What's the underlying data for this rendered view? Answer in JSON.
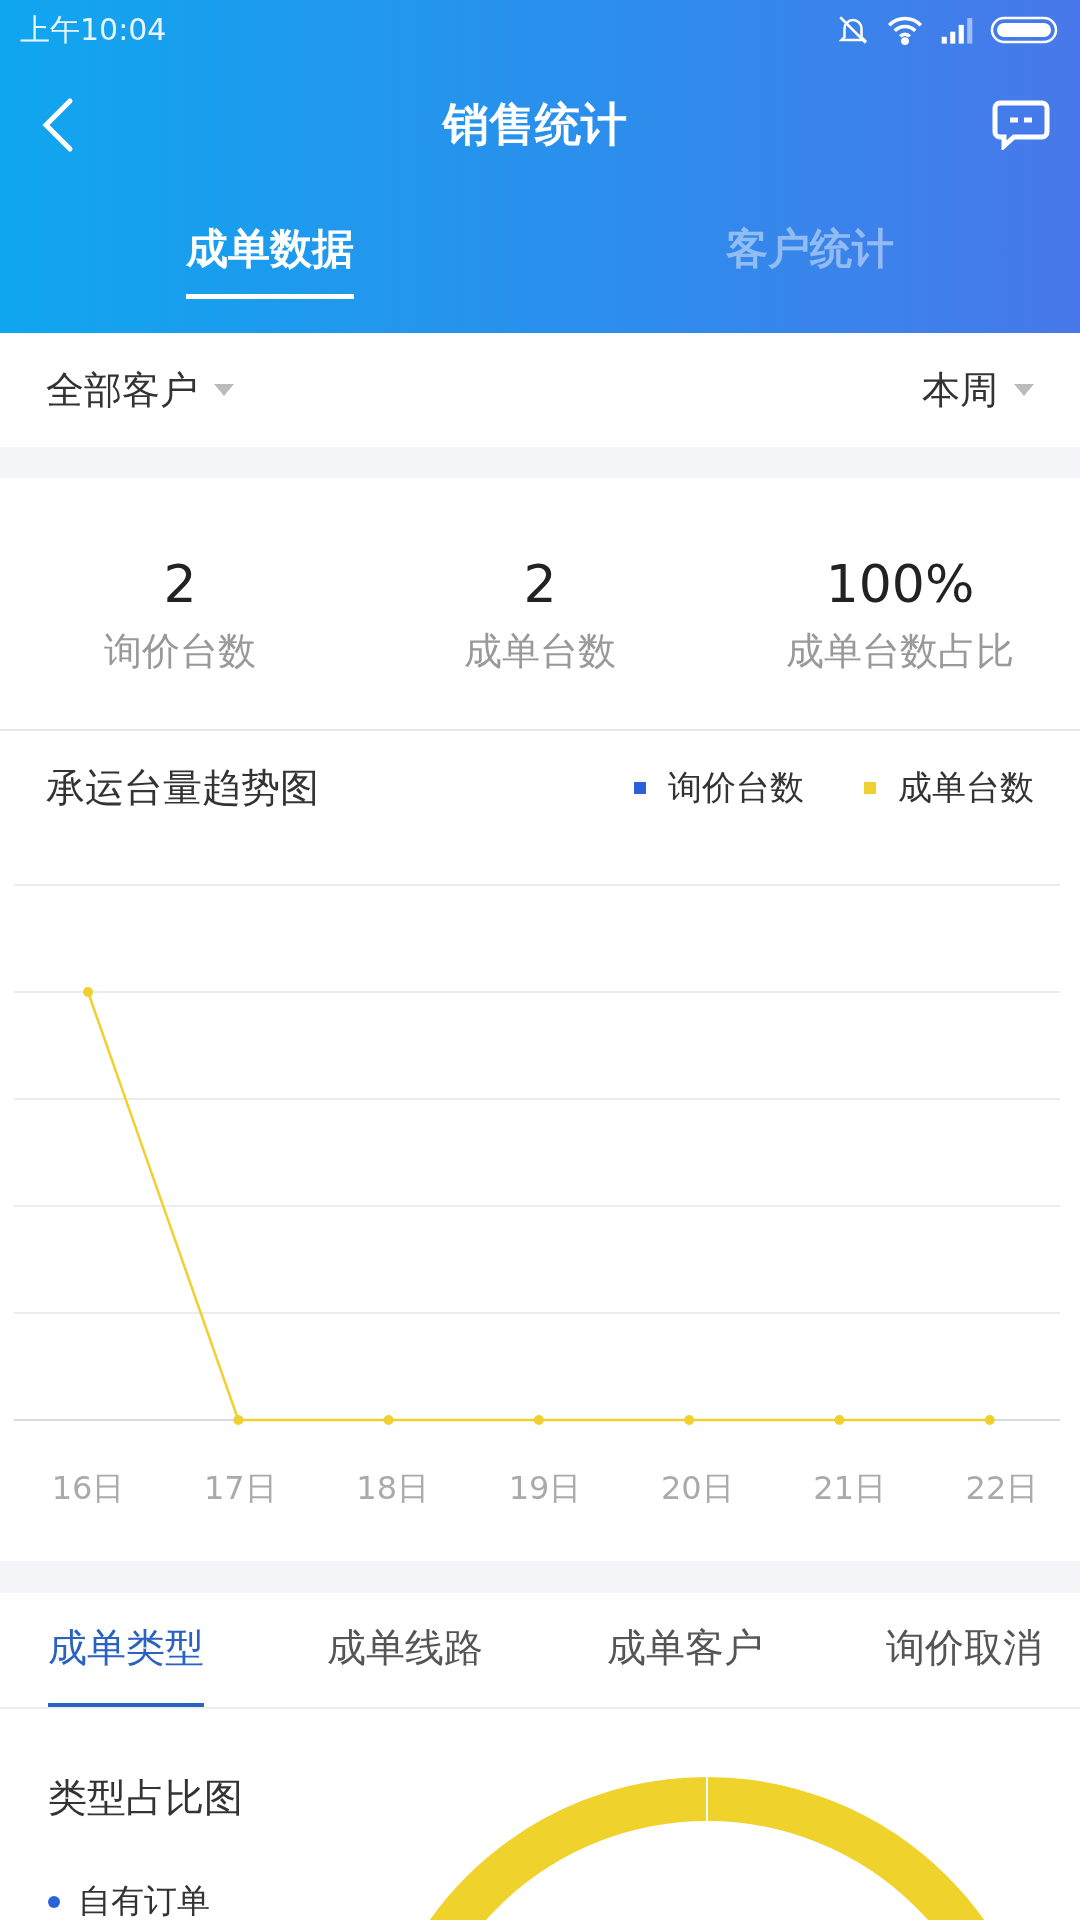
{
  "status_bar": {
    "time": "上午10:04"
  },
  "header": {
    "title": "销售统计"
  },
  "tabs": [
    {
      "label": "成单数据",
      "selected": true
    },
    {
      "label": "客户统计",
      "selected": false
    }
  ],
  "filters": [
    {
      "label": "全部客户"
    },
    {
      "label": "本周"
    }
  ],
  "stats": [
    {
      "value": "2",
      "label": "询价台数"
    },
    {
      "value": "2",
      "label": "成单台数"
    },
    {
      "value": "100%",
      "label": "成单台数占比"
    }
  ],
  "trend": {
    "title": "承运台量趋势图",
    "legend": [
      {
        "label": "询价台数",
        "color": "#2a62d8"
      },
      {
        "label": "成单台数",
        "color": "#f0d030"
      }
    ],
    "x_labels": [
      "16日",
      "17日",
      "18日",
      "19日",
      "20日",
      "21日",
      "22日"
    ]
  },
  "sub_tabs": [
    {
      "label": "成单类型",
      "selected": true
    },
    {
      "label": "成单线路",
      "selected": false
    },
    {
      "label": "成单客户",
      "selected": false
    },
    {
      "label": "询价取消",
      "selected": false
    }
  ],
  "type_chart": {
    "title": "类型占比图",
    "legend": [
      {
        "label": "自有订单",
        "color": "#2a62d8"
      }
    ]
  }
}
